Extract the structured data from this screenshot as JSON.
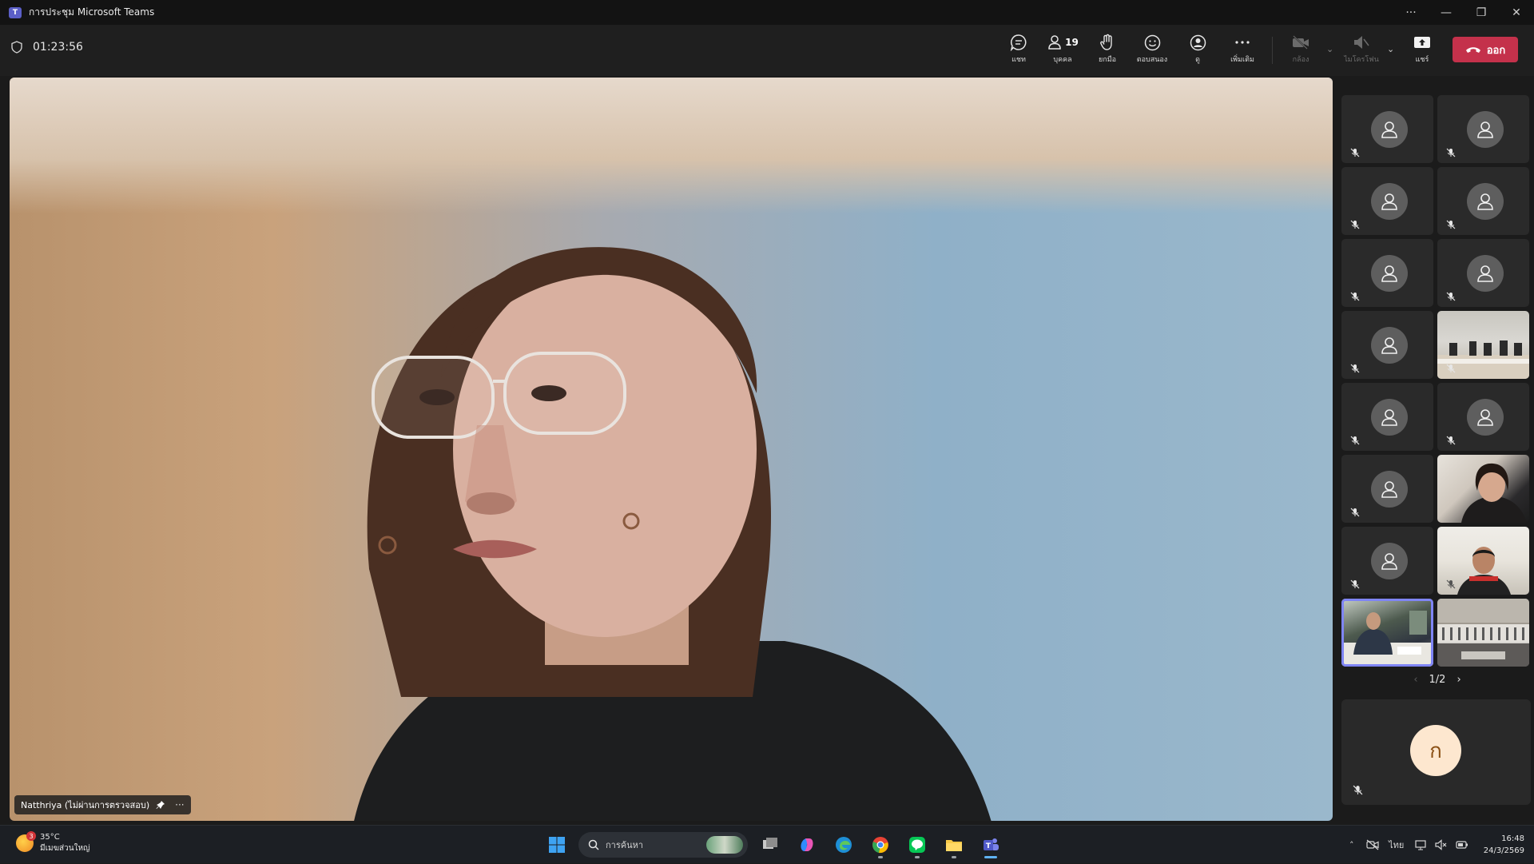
{
  "window": {
    "title": "การประชุม Microsoft Teams"
  },
  "meeting": {
    "timer": "01:23:56",
    "toolbar": {
      "chat": "แชท",
      "people": "บุคคล",
      "people_count": "19",
      "raise": "ยกมือ",
      "react": "ตอบสนอง",
      "view": "ดู",
      "more": "เพิ่มเติม",
      "camera": "กล้อง",
      "mic": "ไมโครโฟน",
      "share": "แชร์",
      "leave": "ออก"
    },
    "stage": {
      "speaker_name": "Natthriya (ไม่ผ่านการตรวจสอบ)"
    },
    "roster": {
      "page": "1/2"
    },
    "self": {
      "initial": "ก"
    }
  },
  "taskbar": {
    "weather_temp": "35°C",
    "weather_desc": "มีเมฆส่วนใหญ่",
    "weather_badge": "3",
    "search_placeholder": "การค้นหา",
    "lang": "ไทย",
    "time": "16:48",
    "date": "24/3/2569"
  }
}
